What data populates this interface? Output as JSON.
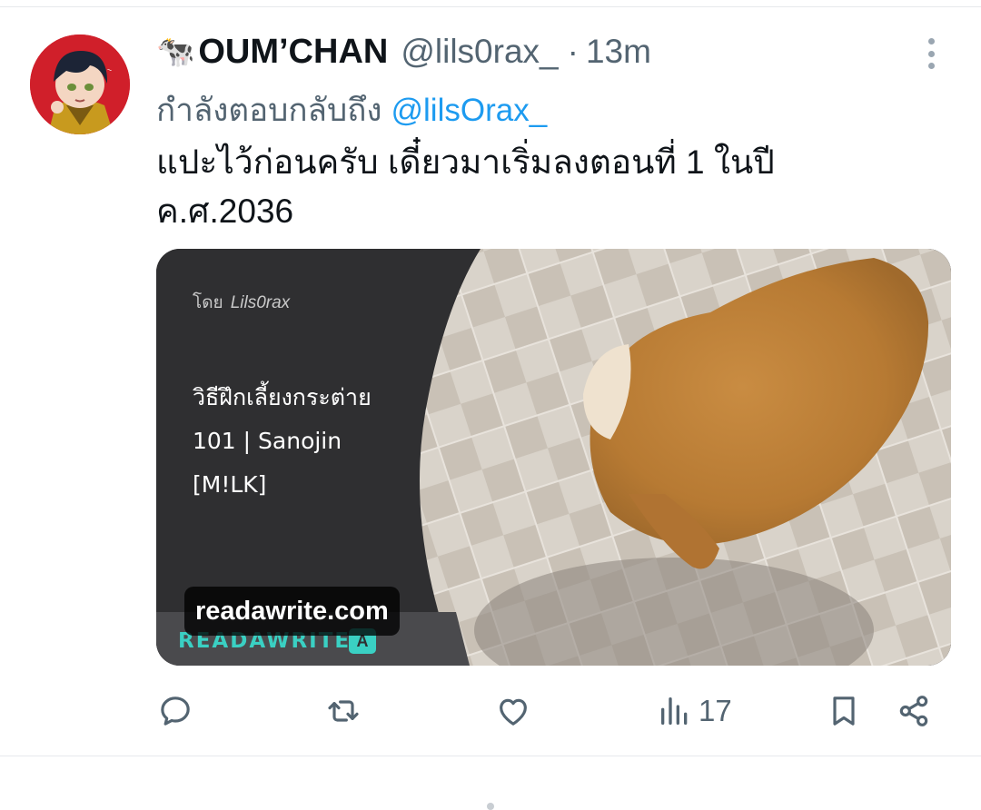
{
  "tweet": {
    "display_name": "OUM’CHAN",
    "name_emoji": "🐄",
    "handle": "@lils0rax_",
    "separator": "·",
    "time": "13m",
    "reply_prefix": "กำลังตอบกลับถึง",
    "reply_to": "@lilsOrax_",
    "text": "แปะไว้ก่อนครับ เดี๋ยวมาเริ่มลงตอนที่ 1 ในปี ค.ศ.2036"
  },
  "card": {
    "author_prefix": "โดย",
    "author": "Lils0rax",
    "title": "วิธีฝึกเลี้ยงกระต่าย 101 | Sanojin [M!LK]",
    "domain": "readawrite.com",
    "brand": "READAWRITE",
    "brand_icon": "A"
  },
  "actions": {
    "views_count": "17"
  },
  "icons": {
    "reply": "reply-icon",
    "retweet": "retweet-icon",
    "like": "heart-icon",
    "views": "views-icon",
    "bookmark": "bookmark-icon",
    "share": "share-icon",
    "more": "more-icon"
  },
  "colors": {
    "link": "#1d9bf0",
    "muted": "#536471",
    "brand_teal": "#3ad0c3",
    "card_dark": "#2f2f31"
  }
}
